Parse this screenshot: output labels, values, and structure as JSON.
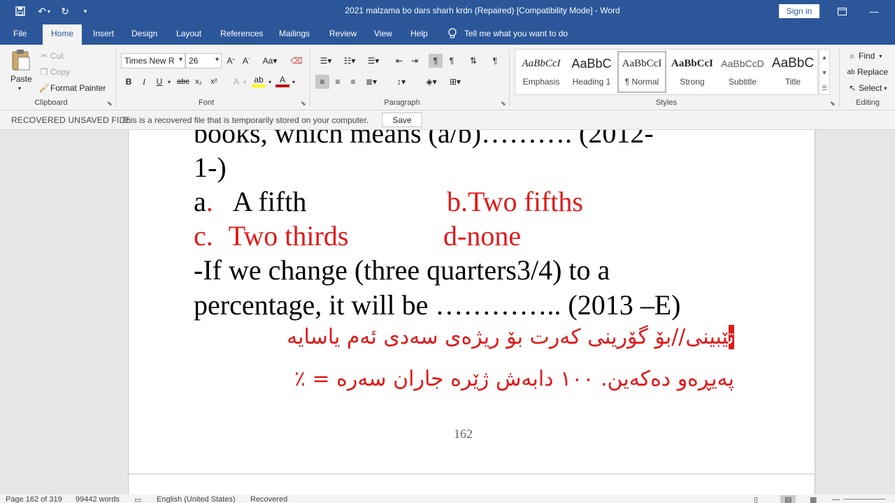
{
  "window": {
    "title": "2021 malzama bo  dars sharh krdn (Repaired) [Compatibility Mode]  -  Word",
    "sign_in": "Sign in"
  },
  "tabs": [
    "File",
    "Home",
    "Insert",
    "Design",
    "Layout",
    "References",
    "Mailings",
    "Review",
    "View",
    "Help"
  ],
  "active_tab": "Home",
  "tell_me": "Tell me what you want to do",
  "clipboard": {
    "paste": "Paste",
    "cut": "Cut",
    "copy": "Copy",
    "format_painter": "Format Painter",
    "label": "Clipboard"
  },
  "font": {
    "name": "Times New R",
    "size": "26",
    "label": "Font"
  },
  "paragraph": {
    "label": "Paragraph"
  },
  "styles": {
    "label": "Styles",
    "items": [
      {
        "sample": "AaBbCcI",
        "name": "Emphasis"
      },
      {
        "sample": "AaBbC",
        "name": "Heading 1"
      },
      {
        "sample": "AaBbCcI",
        "name": "¶ Normal"
      },
      {
        "sample": "AaBbCcI",
        "name": "Strong"
      },
      {
        "sample": "AaBbCcD",
        "name": "Subtitle"
      },
      {
        "sample": "AaBbC",
        "name": "Title"
      }
    ]
  },
  "editing": {
    "find": "Find",
    "replace": "Replace",
    "select": "Select",
    "label": "Editing"
  },
  "infobar": {
    "title": "RECOVERED UNSAVED FILE",
    "message": "This is a recovered file that is temporarily stored on your computer.",
    "save": "Save"
  },
  "document": {
    "line1": "books, which means  (a/b)………. (2012-",
    "line2": "1-)",
    "opt_a_letter": "a",
    "opt_a_dot": ".",
    "opt_a_text": "A fifth",
    "opt_b": "b.Two fifths",
    "opt_c_letter": "c.",
    "opt_c_text": "Two thirds",
    "opt_d": "d-none",
    "line5": "-If we change (three quarters3/4) to a",
    "line6": "percentage, it will be ………….. (2013 –E)",
    "kurdish1_first": "ت",
    "kurdish1_rest": "ێبینی//بۆ گۆرینی کەرت بۆ ریژەی سەدی ئەم یاسایە",
    "kurdish2": "پەیڕەو دەکەین. ١٠٠ دابەش ژێرە جاران سەرە = ٪",
    "page_number": "162"
  },
  "status": {
    "page": "Page 162 of 319",
    "words": "99442 words",
    "language": "English (United States)",
    "recovered": "Recovered"
  }
}
